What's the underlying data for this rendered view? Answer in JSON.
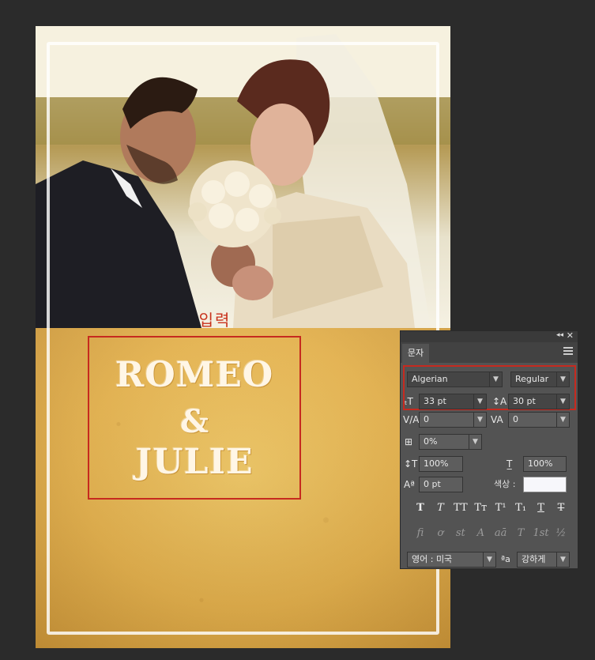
{
  "document": {
    "photo_alt": "bride and groom with bouquet",
    "type_label": "입력",
    "title_lines": [
      "ROMEO",
      "&",
      "JULIE"
    ]
  },
  "character_panel": {
    "tab_label": "문자",
    "font_family": "Algerian",
    "font_style": "Regular",
    "font_size": "33 pt",
    "leading": "30 pt",
    "kerning": "0",
    "tracking": "0",
    "tsume": "0%",
    "vertical_scale": "100%",
    "horizontal_scale": "100%",
    "baseline_shift": "0 pt",
    "color_label": "색상 :",
    "color_value": "#f7f7fb",
    "style_buttons": [
      "T",
      "T",
      "TT",
      "Tт",
      "T¹",
      "T₁",
      "T",
      "T"
    ],
    "opentype_buttons": [
      "fi",
      "ơ",
      "st",
      "A",
      "aā",
      "T",
      "1st",
      "½"
    ],
    "language": "영어 : 미국",
    "antialias_icon": "ªa",
    "antialias": "강하게"
  }
}
